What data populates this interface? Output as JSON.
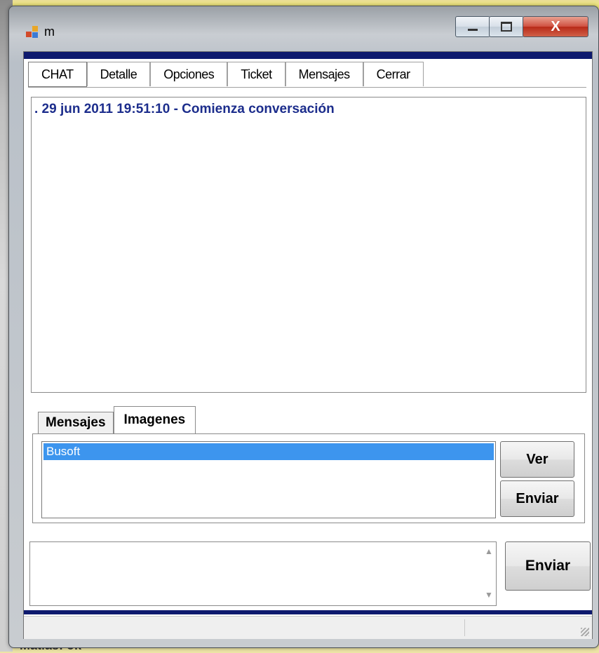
{
  "window": {
    "title": "m",
    "min_icon": "minimize-icon",
    "max_icon": "maximize-icon",
    "close_label": "X"
  },
  "main_tabs": [
    {
      "label": "CHAT"
    },
    {
      "label": "Detalle"
    },
    {
      "label": "Opciones"
    },
    {
      "label": "Ticket"
    },
    {
      "label": "Mensajes"
    },
    {
      "label": "Cerrar"
    }
  ],
  "chat": {
    "lines": [
      ". 29 jun 2011 19:51:10 - Comienza conversación"
    ]
  },
  "sub_tabs": [
    {
      "label": "Mensajes"
    },
    {
      "label": "Imagenes"
    }
  ],
  "images": {
    "items": [
      "Busoft"
    ],
    "view_button": "Ver",
    "send_button": "Enviar"
  },
  "compose": {
    "value": "",
    "send_button": "Enviar"
  },
  "background": {
    "partial_text": "Matias: ok"
  },
  "colors": {
    "accent_bar": "#0e1a6e",
    "chat_text": "#1c2d8c",
    "selection": "#3d95ee"
  }
}
